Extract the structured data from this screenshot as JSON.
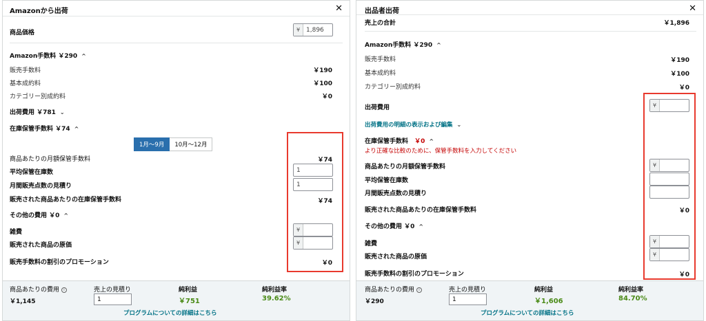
{
  "left": {
    "title": "Amazonから出荷",
    "price_label": "商品価格",
    "price_value": "1,896",
    "yen": "¥",
    "amazon_fee_header": "Amazon手数料 ￥290",
    "sales_fee_label": "販売手数料",
    "sales_fee_value": "￥190",
    "basic_fee_label": "基本成約料",
    "basic_fee_value": "￥100",
    "category_fee_label": "カテゴリー別成約料",
    "category_fee_value": "￥0",
    "shipping_header": "出荷費用 ￥781",
    "storage_header": "在庫保管手数料 ￥74",
    "toggle_a": "1月〜9月",
    "toggle_b": "10月〜12月",
    "monthly_fee_label": "商品あたりの月額保管手数料",
    "monthly_fee_value": "￥74",
    "avg_stock_label": "平均保管在庫数",
    "avg_stock_value": "1",
    "monthly_sales_label": "月間販売点数の見積り",
    "monthly_sales_value": "1",
    "sold_storage_label": "販売された商品あたりの在庫保管手数料",
    "sold_storage_value": "￥74",
    "other_header": "その他の費用 ￥0",
    "misc_label": "雑費",
    "cost_label": "販売された商品の原価",
    "promo_label": "販売手数料の割引のプロモーション",
    "promo_value": "￥0",
    "footer": {
      "cost_label": "商品あたりの費用",
      "cost_value": "￥1,145",
      "sales_label": "売上の見積り",
      "sales_value": "1",
      "profit_label": "純利益",
      "profit_value": "￥751",
      "margin_label": "純利益率",
      "margin_value": "39.62%",
      "link": "プログラムについての詳細はこちら"
    }
  },
  "right": {
    "title": "出品者出荷",
    "total_label": "売上の合計",
    "total_value": "￥1,896",
    "yen": "¥",
    "amazon_fee_header": "Amazon手数料 ￥290",
    "sales_fee_label": "販売手数料",
    "sales_fee_value": "￥190",
    "basic_fee_label": "基本成約料",
    "basic_fee_value": "￥100",
    "category_fee_label": "カテゴリー別成約料",
    "category_fee_value": "￥0",
    "shipping_label": "出荷費用",
    "shipping_detail_link": "出荷費用の明細の表示および編集",
    "storage_header_a": "在庫保管手数料",
    "storage_header_b": "￥0",
    "storage_warning": "より正確な比較のために、保管手数料を入力してください",
    "monthly_fee_label": "商品あたりの月額保管手数料",
    "avg_stock_label": "平均保管在庫数",
    "monthly_sales_label": "月間販売点数の見積り",
    "sold_storage_label": "販売された商品あたりの在庫保管手数料",
    "sold_storage_value": "￥0",
    "other_header": "その他の費用 ￥0",
    "misc_label": "雑費",
    "cost_label": "販売された商品の原価",
    "promo_label": "販売手数料の割引のプロモーション",
    "promo_value": "￥0",
    "footer": {
      "cost_label": "商品あたりの費用",
      "cost_value": "￥290",
      "sales_label": "売上の見積り",
      "sales_value": "1",
      "profit_label": "純利益",
      "profit_value": "￥1,606",
      "margin_label": "純利益率",
      "margin_value": "84.70%",
      "link": "プログラムについての詳細はこちら"
    }
  },
  "icons": {
    "close": "close-icon",
    "chevron_up": "chevron-up-icon",
    "chevron_down": "chevron-down-icon",
    "info": "info-icon"
  },
  "colors": {
    "profit_green": "#4a8a16",
    "link_teal": "#007185",
    "highlight_red": "#e8392d",
    "toggle_blue": "#2a6fad",
    "warning_red": "#c40000"
  }
}
